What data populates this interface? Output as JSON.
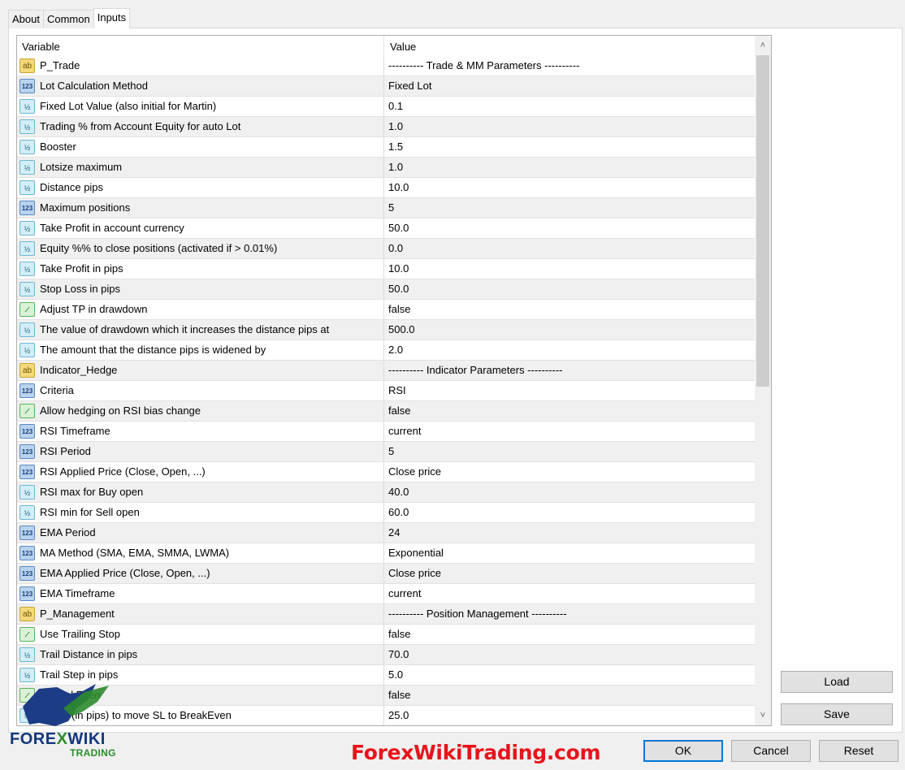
{
  "tabs": [
    {
      "label": "About"
    },
    {
      "label": "Common"
    },
    {
      "label": "Inputs"
    }
  ],
  "grid": {
    "header_variable": "Variable",
    "header_value": "Value",
    "rows": [
      {
        "type": "str",
        "icon_text": "ab",
        "name": "P_Trade",
        "value": "---------- Trade & MM Parameters ----------"
      },
      {
        "type": "int",
        "icon_text": "123",
        "name": "Lot Calculation Method",
        "value": "Fixed Lot"
      },
      {
        "type": "dbl",
        "icon_text": "½",
        "name": "Fixed Lot Value (also initial for Martin)",
        "value": "0.1"
      },
      {
        "type": "dbl",
        "icon_text": "½",
        "name": "Trading % from Account Equity for auto Lot",
        "value": "1.0"
      },
      {
        "type": "dbl",
        "icon_text": "½",
        "name": "Booster",
        "value": "1.5"
      },
      {
        "type": "dbl",
        "icon_text": "½",
        "name": "Lotsize maximum",
        "value": "1.0"
      },
      {
        "type": "dbl",
        "icon_text": "½",
        "name": "Distance pips",
        "value": "10.0"
      },
      {
        "type": "int",
        "icon_text": "123",
        "name": "Maximum positions",
        "value": "5"
      },
      {
        "type": "dbl",
        "icon_text": "½",
        "name": "Take Profit in account currency",
        "value": "50.0"
      },
      {
        "type": "dbl",
        "icon_text": "½",
        "name": "Equity %% to close positions (activated if > 0.01%)",
        "value": "0.0"
      },
      {
        "type": "dbl",
        "icon_text": "½",
        "name": "Take Profit in pips",
        "value": "10.0"
      },
      {
        "type": "dbl",
        "icon_text": "½",
        "name": "Stop Loss in pips",
        "value": "50.0"
      },
      {
        "type": "bool",
        "icon_text": "⟋",
        "name": "Adjust TP in drawdown",
        "value": "false"
      },
      {
        "type": "dbl",
        "icon_text": "½",
        "name": "The value of drawdown which it increases the distance pips at",
        "value": "500.0"
      },
      {
        "type": "dbl",
        "icon_text": "½",
        "name": "The amount that the distance pips is widened by",
        "value": "2.0"
      },
      {
        "type": "str",
        "icon_text": "ab",
        "name": "Indicator_Hedge",
        "value": "---------- Indicator Parameters ----------"
      },
      {
        "type": "int",
        "icon_text": "123",
        "name": "Criteria",
        "value": "RSI"
      },
      {
        "type": "bool",
        "icon_text": "⟋",
        "name": "Allow hedging on RSI bias change",
        "value": "false"
      },
      {
        "type": "int",
        "icon_text": "123",
        "name": "RSI Timeframe",
        "value": "current"
      },
      {
        "type": "int",
        "icon_text": "123",
        "name": "RSI Period",
        "value": "5"
      },
      {
        "type": "int",
        "icon_text": "123",
        "name": "RSI Applied Price (Close, Open, ...)",
        "value": "Close price"
      },
      {
        "type": "dbl",
        "icon_text": "½",
        "name": "RSI max for Buy open",
        "value": "40.0"
      },
      {
        "type": "dbl",
        "icon_text": "½",
        "name": "RSI min for Sell open",
        "value": "60.0"
      },
      {
        "type": "int",
        "icon_text": "123",
        "name": "EMA Period",
        "value": "24"
      },
      {
        "type": "int",
        "icon_text": "123",
        "name": "MA Method (SMA, EMA, SMMA, LWMA)",
        "value": "Exponential"
      },
      {
        "type": "int",
        "icon_text": "123",
        "name": "EMA Applied Price (Close, Open, ...)",
        "value": "Close price"
      },
      {
        "type": "int",
        "icon_text": "123",
        "name": "EMA Timeframe",
        "value": "current"
      },
      {
        "type": "str",
        "icon_text": "ab",
        "name": "P_Management",
        "value": "---------- Position Management ----------"
      },
      {
        "type": "bool",
        "icon_text": "⟋",
        "name": "Use Trailing Stop",
        "value": "false"
      },
      {
        "type": "dbl",
        "icon_text": "½",
        "name": "Trail Distance in pips",
        "value": "70.0"
      },
      {
        "type": "dbl",
        "icon_text": "½",
        "name": "Trail Step in pips",
        "value": "5.0"
      },
      {
        "type": "bool",
        "icon_text": "⟋",
        "name": "...BreakEven",
        "value": "false"
      },
      {
        "type": "dbl",
        "icon_text": "½",
        "name": "...hold (in pips) to move SL to BreakEven",
        "value": "25.0"
      }
    ]
  },
  "scrollbar": {
    "up_arrow": "˄",
    "down_arrow": "˅"
  },
  "side_buttons": {
    "load": "Load",
    "save": "Save"
  },
  "footer_buttons": {
    "ok": "OK",
    "cancel": "Cancel",
    "reset": "Reset"
  },
  "watermark": {
    "site": "ForexWikiTrading.com",
    "brand_left": "FORE",
    "brand_x": "X",
    "brand_right": "WIKI",
    "brand_sub": "TRADING"
  }
}
